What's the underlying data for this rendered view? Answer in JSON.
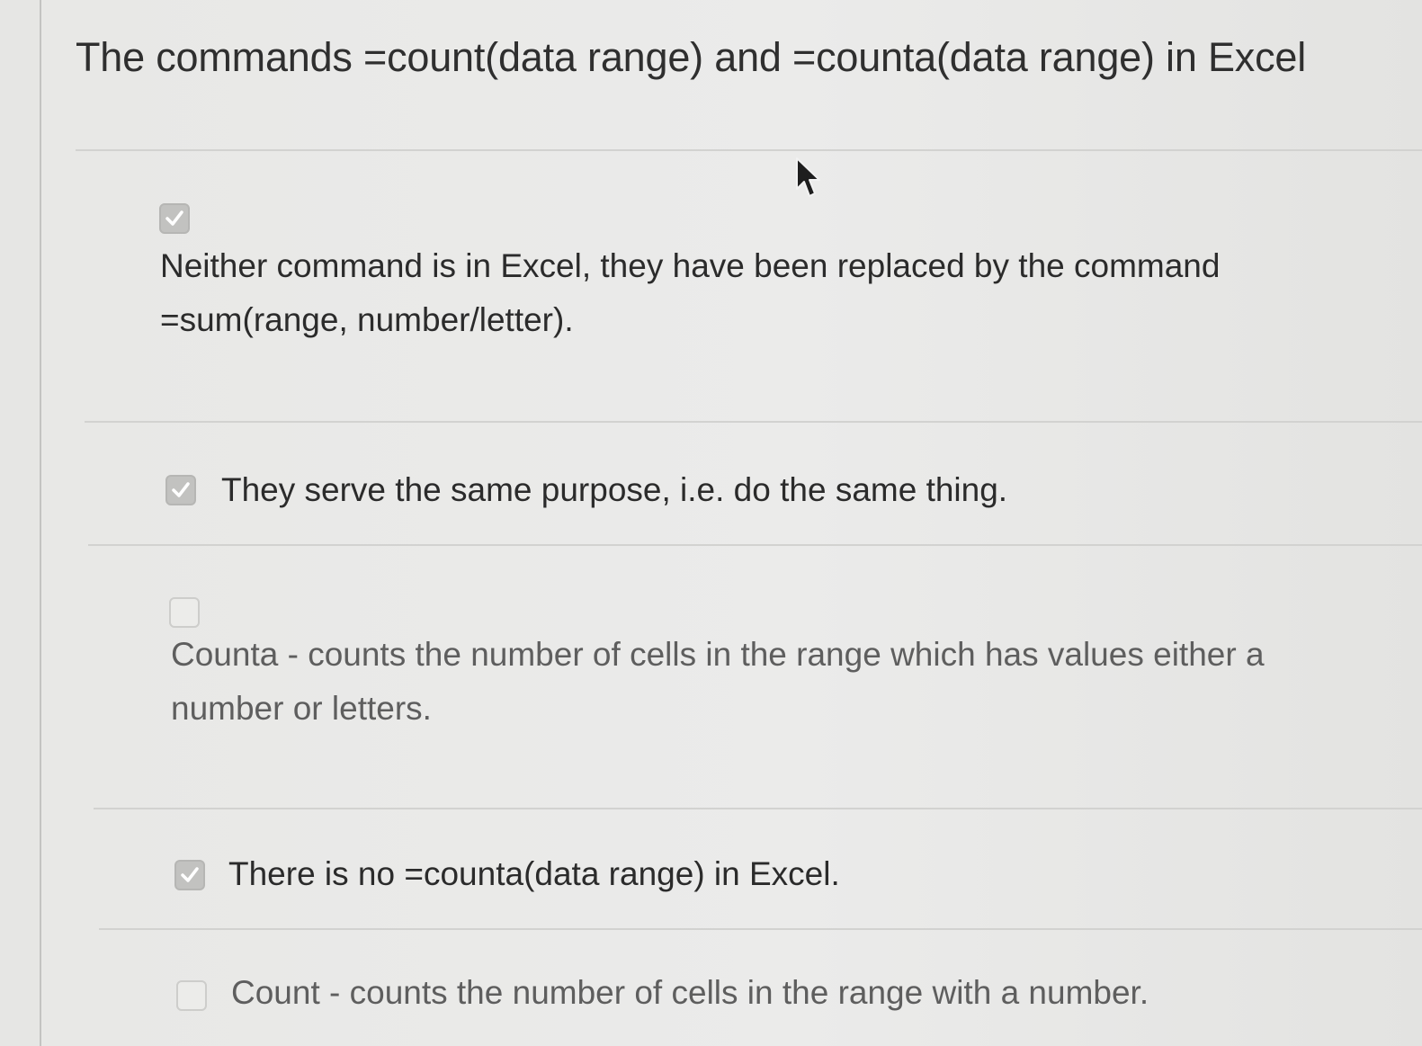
{
  "question": {
    "title": "The commands =count(data range) and =counta(data range) in Excel"
  },
  "options": [
    {
      "text": "Neither command is in Excel, they have been replaced by the command =sum(range, number/letter).",
      "checked": true
    },
    {
      "text": "They serve the same purpose, i.e. do the same thing.",
      "checked": true
    },
    {
      "text": "Counta - counts the number of cells in the range which has values either a number or letters.",
      "checked": false
    },
    {
      "text": "There is no =counta(data range) in Excel.",
      "checked": true
    },
    {
      "text": "Count - counts the number of cells in the range with a number.",
      "checked": false
    }
  ],
  "icons": {
    "checkmark": "check-icon",
    "pointer": "mouse-pointer-icon"
  },
  "colors": {
    "checked_box": "#c2c2c0",
    "text": "#2b2b2b"
  }
}
